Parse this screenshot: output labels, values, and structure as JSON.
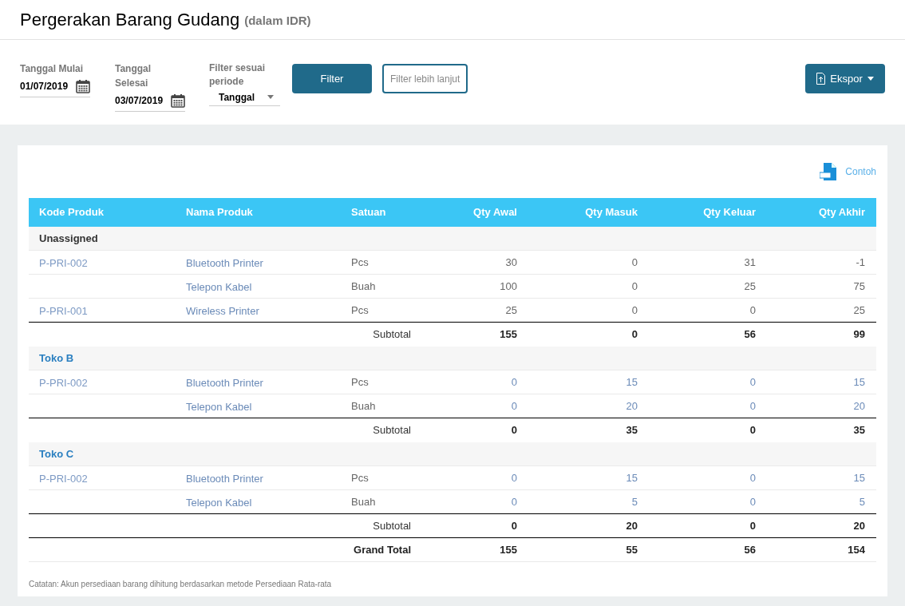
{
  "page": {
    "title": "Pergerakan Barang Gudang",
    "currency_note": "(dalam IDR)"
  },
  "filters": {
    "start": {
      "label": "Tanggal Mulai",
      "value": "01/07/2019"
    },
    "end": {
      "label": "Tanggal Selesai",
      "value": "03/07/2019"
    },
    "period": {
      "label": "Filter sesuai periode",
      "value": "Tanggal"
    },
    "filter_button": "Filter",
    "advanced_button": "Filter lebih lanjut",
    "export_button": "Ekspor"
  },
  "sample_link": "Contoh",
  "table": {
    "columns": [
      "Kode Produk",
      "Nama Produk",
      "Satuan",
      "Qty Awal",
      "Qty Masuk",
      "Qty Keluar",
      "Qty Akhir"
    ],
    "groups": [
      {
        "name": "Unassigned",
        "kind": "plain",
        "rows": [
          {
            "code": "P-PRI-002",
            "name": "Bluetooth Printer",
            "unit": "Pcs",
            "values": [
              "30",
              "0",
              "31",
              "-1"
            ]
          },
          {
            "code": "",
            "name": "Telepon Kabel",
            "unit": "Buah",
            "values": [
              "100",
              "0",
              "25",
              "75"
            ]
          },
          {
            "code": "P-PRI-001",
            "name": "Wireless Printer",
            "unit": "Pcs",
            "values": [
              "25",
              "0",
              "0",
              "25"
            ]
          }
        ],
        "subtotal": {
          "label": "Subtotal",
          "values": [
            "155",
            "0",
            "56",
            "99"
          ]
        }
      },
      {
        "name": "Toko B",
        "kind": "link",
        "rows": [
          {
            "code": "P-PRI-002",
            "name": "Bluetooth Printer",
            "unit": "Pcs",
            "values": [
              "0",
              "15",
              "0",
              "15"
            ]
          },
          {
            "code": "",
            "name": "Telepon Kabel",
            "unit": "Buah",
            "values": [
              "0",
              "20",
              "0",
              "20"
            ]
          }
        ],
        "subtotal": {
          "label": "Subtotal",
          "values": [
            "0",
            "35",
            "0",
            "35"
          ]
        }
      },
      {
        "name": "Toko C",
        "kind": "link",
        "rows": [
          {
            "code": "P-PRI-002",
            "name": "Bluetooth Printer",
            "unit": "Pcs",
            "values": [
              "0",
              "15",
              "0",
              "15"
            ]
          },
          {
            "code": "",
            "name": "Telepon Kabel",
            "unit": "Buah",
            "values": [
              "0",
              "5",
              "0",
              "5"
            ]
          }
        ],
        "subtotal": {
          "label": "Subtotal",
          "values": [
            "0",
            "20",
            "0",
            "20"
          ]
        }
      }
    ],
    "grand_total": {
      "label": "Grand Total",
      "values": [
        "155",
        "55",
        "56",
        "154"
      ]
    }
  },
  "note": "Catatan: Akun persediaan barang dihitung berdasarkan metode Persediaan Rata-rata"
}
